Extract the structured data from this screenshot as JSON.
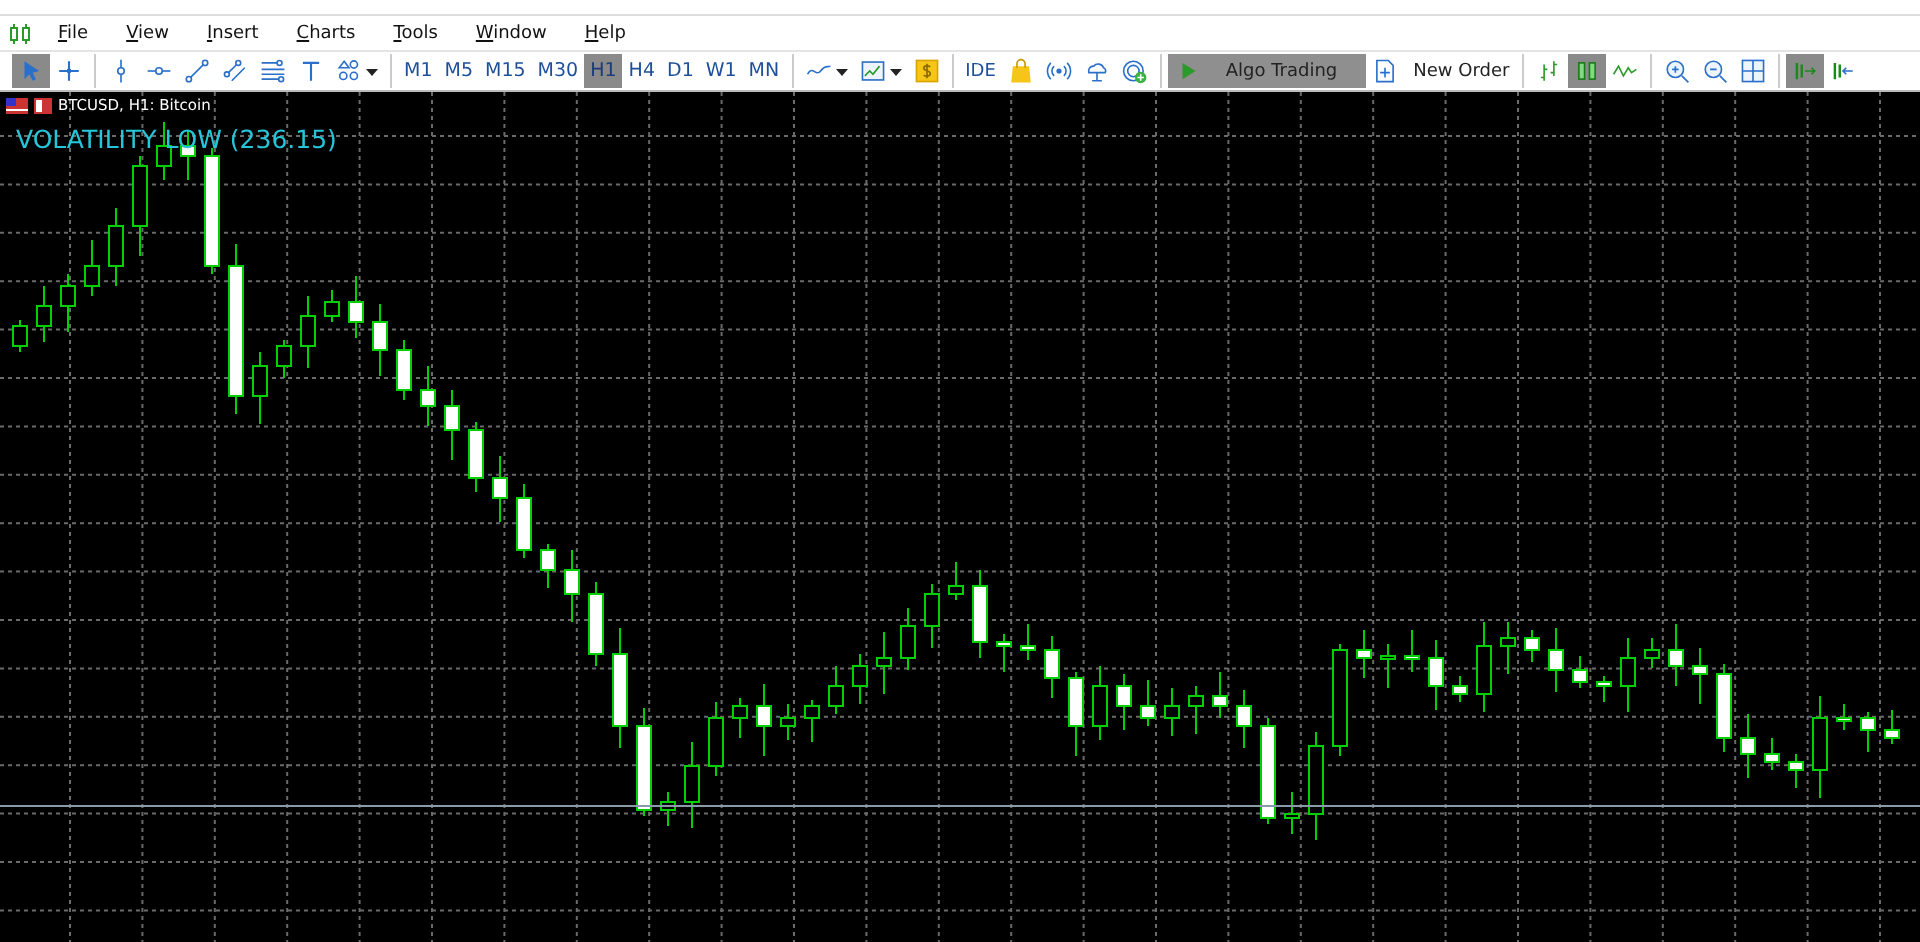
{
  "menu": [
    {
      "label": "File"
    },
    {
      "label": "View"
    },
    {
      "label": "Insert"
    },
    {
      "label": "Charts"
    },
    {
      "label": "Tools"
    },
    {
      "label": "Window"
    },
    {
      "label": "Help"
    }
  ],
  "toolbar": {
    "groups": [
      [
        {
          "kind": "cursor",
          "selected": true
        },
        {
          "kind": "crosshair",
          "selected": false
        }
      ],
      [
        {
          "kind": "vline",
          "selected": false
        },
        {
          "kind": "hline",
          "selected": false
        },
        {
          "kind": "trendline",
          "selected": false
        },
        {
          "kind": "channel",
          "selected": false
        },
        {
          "kind": "fibo",
          "selected": false
        },
        {
          "kind": "text",
          "selected": false
        },
        {
          "kind": "shapes",
          "selected": false
        }
      ],
      [
        {
          "kind": "timeframe",
          "label": "M1",
          "selected": false
        },
        {
          "kind": "timeframe",
          "label": "M5",
          "selected": false
        },
        {
          "kind": "timeframe",
          "label": "M15",
          "selected": false
        },
        {
          "kind": "timeframe",
          "label": "M30",
          "selected": false
        },
        {
          "kind": "timeframe",
          "label": "H1",
          "selected": true
        },
        {
          "kind": "timeframe",
          "label": "H4",
          "selected": false
        },
        {
          "kind": "timeframe",
          "label": "D1",
          "selected": false
        },
        {
          "kind": "timeframe",
          "label": "W1",
          "selected": false
        },
        {
          "kind": "timeframe",
          "label": "MN",
          "selected": false
        }
      ],
      [
        {
          "kind": "indicators"
        },
        {
          "kind": "templates"
        },
        {
          "kind": "market"
        }
      ],
      [
        {
          "kind": "ide",
          "label": "IDE"
        },
        {
          "kind": "bag"
        },
        {
          "kind": "signals"
        },
        {
          "kind": "cloud"
        },
        {
          "kind": "vps"
        }
      ],
      [
        {
          "kind": "algo",
          "label": "Algo Trading",
          "on": true
        },
        {
          "kind": "new-order",
          "label": "New Order"
        }
      ],
      [
        {
          "kind": "bar-chart",
          "selected": false
        },
        {
          "kind": "candle-chart",
          "selected": true
        },
        {
          "kind": "line-chart",
          "selected": false
        }
      ],
      [
        {
          "kind": "zoom-in"
        },
        {
          "kind": "zoom-out"
        },
        {
          "kind": "tile"
        }
      ],
      [
        {
          "kind": "autoscroll",
          "on": true
        },
        {
          "kind": "shift",
          "on": false
        }
      ]
    ]
  },
  "chart": {
    "header": "BTCUSD, H1: Bitcoin",
    "indicator": "VOLATILITY LOW (236.15)"
  }
}
